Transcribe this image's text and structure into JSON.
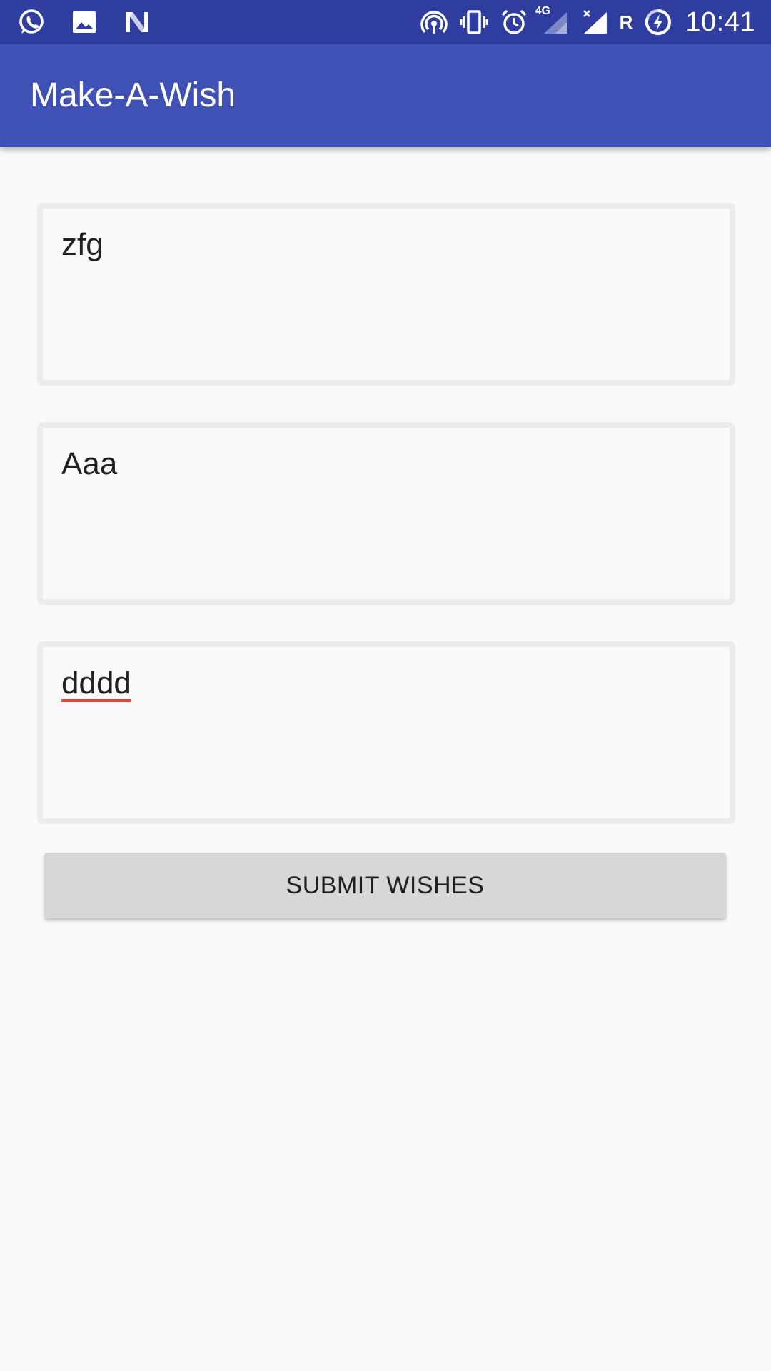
{
  "status_bar": {
    "left_icons": [
      "whatsapp-icon",
      "image-icon",
      "n-logo-icon"
    ],
    "right_icons": [
      "hotspot-icon",
      "vibrate-icon",
      "alarm-icon",
      "signal-4g-icon",
      "signal-no-service-icon",
      "roaming-indicator",
      "battery-charging-icon"
    ],
    "network_label": "4G",
    "roaming_label": "R",
    "time": "10:41",
    "color": "#2f3e9e"
  },
  "app_bar": {
    "title": "Make-A-Wish",
    "color": "#3f51b5"
  },
  "wishes": [
    {
      "value": "zfg"
    },
    {
      "value": "Aaa"
    },
    {
      "value": "dddd",
      "spellcheck_flagged": true
    }
  ],
  "submit_button": {
    "label": "SUBMIT WISHES"
  },
  "colors": {
    "background": "#fafafa",
    "field_border": "#ececec",
    "button": "#d6d7d7",
    "spellcheck_underline": "#f44336"
  }
}
